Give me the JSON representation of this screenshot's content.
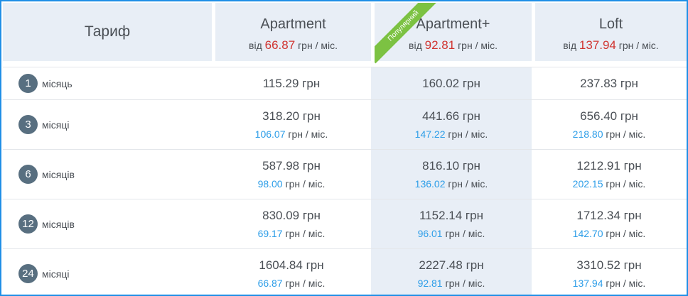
{
  "header": {
    "tariff_label": "Тариф",
    "from_label": "від",
    "currency_per_month": "грн / міс.",
    "plans": [
      {
        "name": "Apartment",
        "from_price": "66.87"
      },
      {
        "name": "Apartment+",
        "from_price": "92.81",
        "badge": "Популярний"
      },
      {
        "name": "Loft",
        "from_price": "137.94"
      }
    ]
  },
  "currency": "грн",
  "per_month_suffix": "грн / міс.",
  "rows": [
    {
      "months": "1",
      "label": "місяць",
      "prices": [
        {
          "total": "115.29 грн"
        },
        {
          "total": "160.02 грн"
        },
        {
          "total": "237.83 грн"
        }
      ]
    },
    {
      "months": "3",
      "label": "місяці",
      "prices": [
        {
          "total": "318.20 грн",
          "per": "106.07"
        },
        {
          "total": "441.66 грн",
          "per": "147.22"
        },
        {
          "total": "656.40 грн",
          "per": "218.80"
        }
      ]
    },
    {
      "months": "6",
      "label": "місяців",
      "prices": [
        {
          "total": "587.98 грн",
          "per": "98.00"
        },
        {
          "total": "816.10 грн",
          "per": "136.02"
        },
        {
          "total": "1212.91 грн",
          "per": "202.15"
        }
      ]
    },
    {
      "months": "12",
      "label": "місяців",
      "prices": [
        {
          "total": "830.09 грн",
          "per": "69.17"
        },
        {
          "total": "1152.14 грн",
          "per": "96.01"
        },
        {
          "total": "1712.34 грн",
          "per": "142.70"
        }
      ]
    },
    {
      "months": "24",
      "label": "місяці",
      "prices": [
        {
          "total": "1604.84 грн",
          "per": "66.87"
        },
        {
          "total": "2227.48 грн",
          "per": "92.81"
        },
        {
          "total": "3310.52 грн",
          "per": "137.94"
        }
      ]
    }
  ],
  "colors": {
    "border": "#1f8fe6",
    "header_bg": "#e8eef6",
    "price_red": "#d0332f",
    "price_blue": "#2e9ee8",
    "badge_green": "#7cc242",
    "circle": "#586f80"
  }
}
